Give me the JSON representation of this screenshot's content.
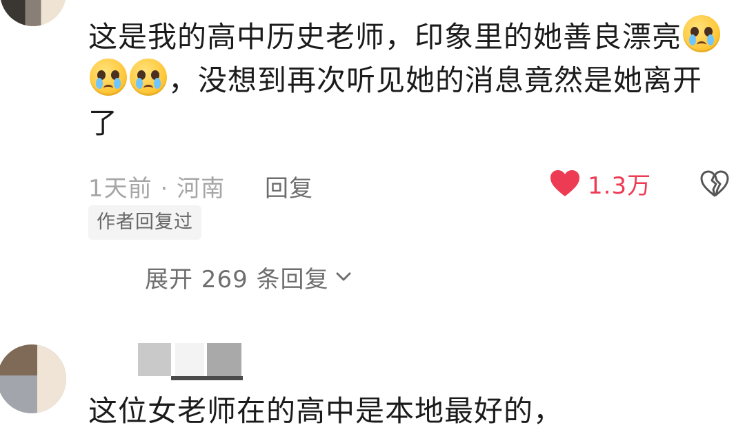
{
  "comment1": {
    "text_line1": "这是我的高中历史老师，印象里的她善良漂亮",
    "text_line2": "，没想到再次听见她的消息竟然是她离开",
    "text_line3": "了",
    "emoji_name": "crying-face-emoji",
    "time": "1天前",
    "separator": "·",
    "location": "河南",
    "reply_label": "回复",
    "like_count": "1.3万",
    "author_badge": "作者回复过",
    "expand_label": "展开 269 条回复"
  },
  "comment2": {
    "text": "这位女老师在的高中是本地最好的，"
  },
  "colors": {
    "heart": "#ee3b54",
    "meta_text": "#a6a6a6",
    "badge_bg": "#f4f4f4"
  },
  "icons": {
    "like": "heart-icon",
    "dislike": "broken-heart-icon",
    "expand": "chevron-down-icon"
  }
}
